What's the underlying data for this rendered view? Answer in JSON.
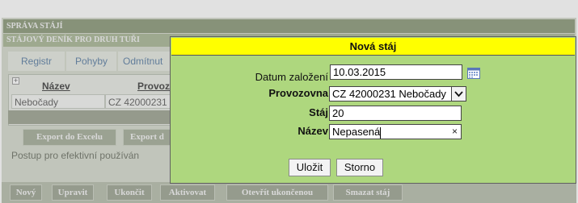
{
  "header": {
    "title": "Správa stájí",
    "subtitle": "Stájový deník pro druh tuři"
  },
  "tabs": [
    {
      "label": "Registr"
    },
    {
      "label": "Pohyby"
    },
    {
      "label": "Odmítnut"
    }
  ],
  "table": {
    "expand_glyph": "+",
    "columns": [
      "Název",
      "Provoz"
    ],
    "rows": [
      {
        "nazev": "Nebočady",
        "provozovna": "CZ 42000231"
      }
    ]
  },
  "export_buttons": [
    {
      "label": "Export do Excelu"
    },
    {
      "label": "Export d"
    }
  ],
  "postup_text": "Postup pro efektivní používán",
  "footer_buttons": [
    {
      "label": "Nový"
    },
    {
      "label": "Upravit"
    },
    {
      "label": "Ukončit"
    },
    {
      "label": "Aktivovat"
    },
    {
      "label": "Otevřít ukončenou"
    },
    {
      "label": "Smazat stáj"
    }
  ],
  "dialog": {
    "title": "Nová stáj",
    "fields": {
      "datum": {
        "label": "Datum založení",
        "value": "10.03.2015"
      },
      "provozovna": {
        "label": "Provozovna",
        "value": "CZ 42000231 Nebočady"
      },
      "staj": {
        "label": "Stáj",
        "value": "20"
      },
      "nazev": {
        "label": "Název",
        "value": "Nepasená",
        "clear_glyph": "×"
      }
    },
    "buttons": {
      "save": "Uložit",
      "cancel": "Storno"
    }
  },
  "colors": {
    "dialog_bg": "#aed77e",
    "dialog_title_bg": "#ffff00",
    "header_bg": "#8c9a7a"
  },
  "icons": [
    "calendar-icon",
    "chevron-down-icon",
    "clear-icon"
  ]
}
